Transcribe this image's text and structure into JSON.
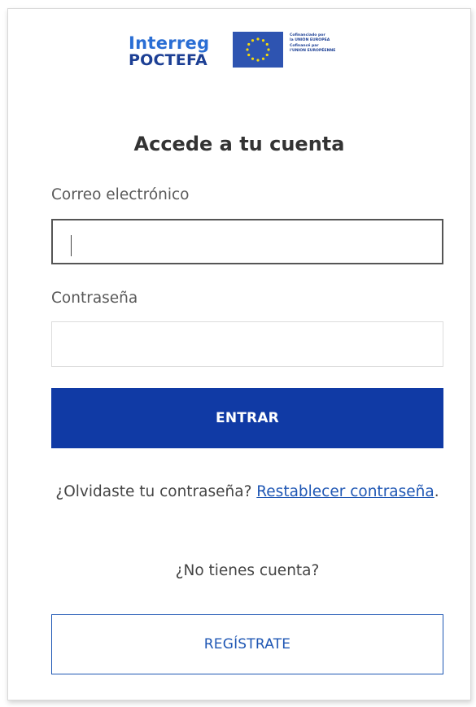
{
  "brand": {
    "name_line1": "Interreg",
    "name_line2": "POCTEFA",
    "eu_caption_es_1": "Cofinanciado por",
    "eu_caption_es_2": "la UNIÓN EUROPEA",
    "eu_caption_fr_1": "Cofinancé par",
    "eu_caption_fr_2": "l'UNION EUROPÉENNE",
    "brand_color": "#1b57b7",
    "flag_color": "#2e54b1",
    "star_color": "#f5d90a"
  },
  "login": {
    "title": "Accede a tu cuenta",
    "email_label": "Correo electrónico",
    "email_value": "",
    "password_label": "Contraseña",
    "password_value": "",
    "submit_label": "ENTRAR",
    "forgot_prefix": "¿Olvidaste tu contraseña?",
    "forgot_link": "Restablecer contraseña",
    "forgot_suffix": ".",
    "no_account_text": "¿No tienes cuenta?",
    "register_label": "REGÍSTRATE",
    "primary_color": "#103aa5",
    "link_color": "#1f57b4"
  }
}
